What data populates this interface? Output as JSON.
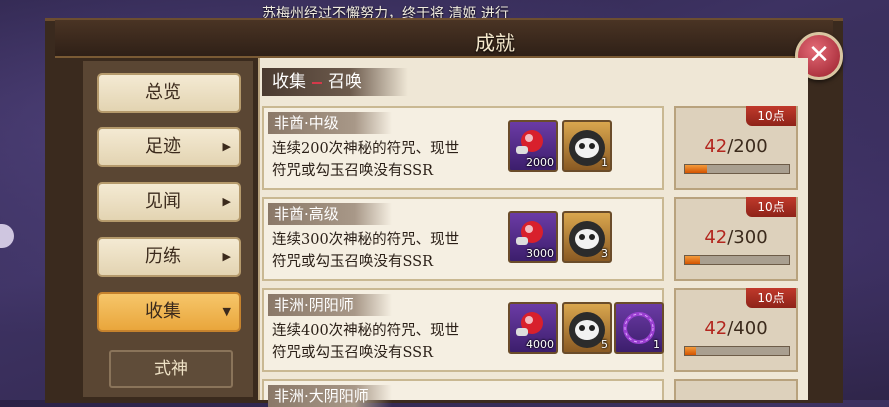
{
  "notice": "苏梅州经过不懈努力，终于将 清姬 进行",
  "window": {
    "title": "成就",
    "close_symbol": "✕"
  },
  "sidebar": {
    "items": [
      {
        "label": "总览",
        "arrow": ""
      },
      {
        "label": "足迹",
        "arrow": "▶"
      },
      {
        "label": "见闻",
        "arrow": "▶"
      },
      {
        "label": "历练",
        "arrow": "▶"
      },
      {
        "label": "收集",
        "arrow": "▼"
      }
    ],
    "sub_item": "式神"
  },
  "section": {
    "left": "收集",
    "right": "召唤"
  },
  "rows": [
    {
      "name": "非酋·中级",
      "desc1": "连续200次神秘的符咒、现世",
      "desc2": "符咒或勾玉召唤没有SSR",
      "rewards": [
        {
          "icon": "magatama-icon",
          "qty": "2000",
          "style": "purple"
        },
        {
          "icon": "daruma-icon",
          "qty": "1",
          "style": "gold"
        }
      ],
      "points": "10点",
      "progress_cur": "42",
      "progress_total": "/200",
      "progress_fraction": 0.21
    },
    {
      "name": "非酋·高级",
      "desc1": "连续300次神秘的符咒、现世",
      "desc2": "符咒或勾玉召唤没有SSR",
      "rewards": [
        {
          "icon": "magatama-icon",
          "qty": "3000",
          "style": "purple"
        },
        {
          "icon": "daruma-icon",
          "qty": "3",
          "style": "gold"
        }
      ],
      "points": "10点",
      "progress_cur": "42",
      "progress_total": "/300",
      "progress_fraction": 0.14
    },
    {
      "name": "非洲·阴阳师",
      "desc1": "连续400次神秘的符咒、现世",
      "desc2": "符咒或勾玉召唤没有SSR",
      "rewards": [
        {
          "icon": "magatama-icon",
          "qty": "4000",
          "style": "purple"
        },
        {
          "icon": "daruma-icon",
          "qty": "5",
          "style": "gold"
        },
        {
          "icon": "portrait-frame-icon",
          "qty": "1",
          "style": "purple"
        }
      ],
      "points": "10点",
      "progress_cur": "42",
      "progress_total": "/400",
      "progress_fraction": 0.105
    },
    {
      "name": "非洲·大阴阳师",
      "desc1": "",
      "desc2": "",
      "rewards": [],
      "points": "",
      "progress_cur": "",
      "progress_total": "",
      "progress_fraction": 0
    }
  ]
}
